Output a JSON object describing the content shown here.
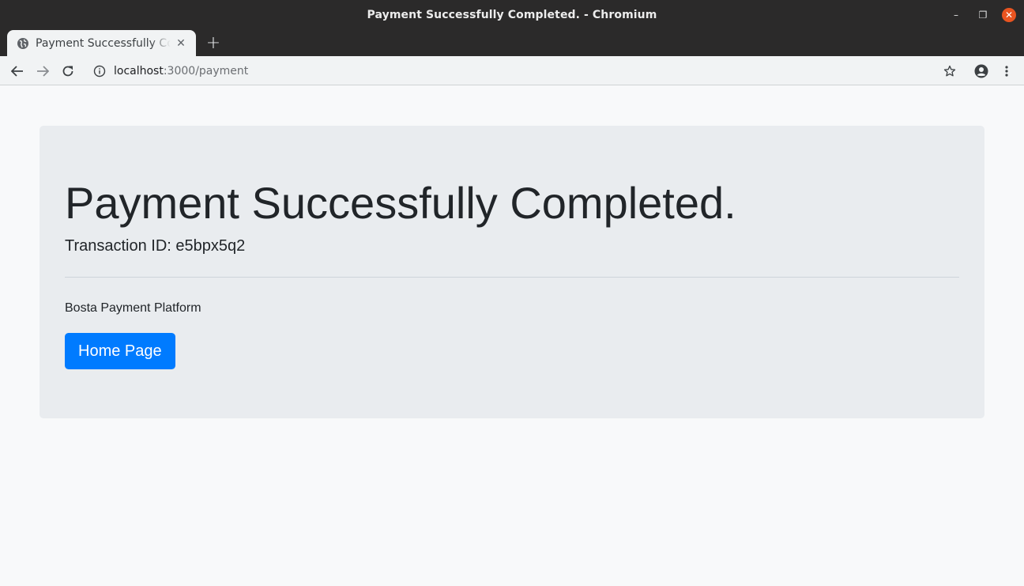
{
  "window": {
    "title": "Payment Successfully Completed. - Chromium",
    "minimize_glyph": "–",
    "restore_glyph": "❐",
    "close_glyph": "✕"
  },
  "tab": {
    "title": "Payment Successfully Completed.",
    "close_glyph": "✕",
    "favicon": "globe-icon"
  },
  "new_tab_glyph": "+",
  "toolbar": {
    "url_host": "localhost",
    "url_rest": ":3000/payment",
    "icons": [
      "back-arrow-icon",
      "forward-arrow-icon",
      "reload-icon",
      "info-icon",
      "star-icon",
      "account-icon",
      "menu-dots-icon"
    ]
  },
  "page": {
    "heading": "Payment Successfully Completed.",
    "transaction": "Transaction ID: e5bpx5q2",
    "platform": "Bosta Payment Platform",
    "button_label": "Home Page"
  },
  "colors": {
    "primary": "#007bff",
    "jumbotron_bg": "#e9ecef",
    "page_bg": "#f8f9fa",
    "titlebar_bg": "#2b2a2a",
    "close_button": "#e95420"
  }
}
